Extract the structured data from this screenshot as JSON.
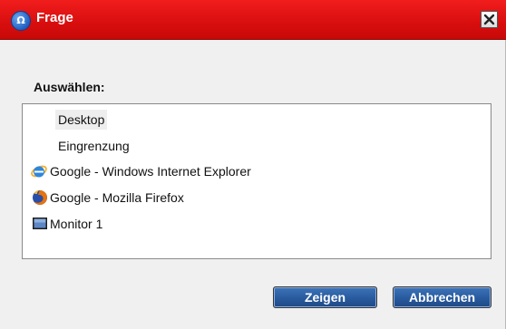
{
  "window": {
    "title": "Frage",
    "close_label": "X"
  },
  "prompt_label": "Auswählen:",
  "list": {
    "items": [
      {
        "label": "Desktop",
        "icon": "none",
        "selected": true
      },
      {
        "label": "Eingrenzung",
        "icon": "none",
        "selected": false
      },
      {
        "label": "Google - Windows Internet Explorer",
        "icon": "internet-explorer-icon",
        "selected": false
      },
      {
        "label": "Google - Mozilla Firefox",
        "icon": "firefox-icon",
        "selected": false
      },
      {
        "label": "Monitor 1",
        "icon": "monitor-icon",
        "selected": false
      }
    ]
  },
  "buttons": {
    "show_label": "Zeigen",
    "cancel_label": "Abbrechen"
  },
  "colors": {
    "titlebar": "#e01212",
    "button": "#2c5fa3",
    "dialog_bg": "#f0f0f0"
  }
}
